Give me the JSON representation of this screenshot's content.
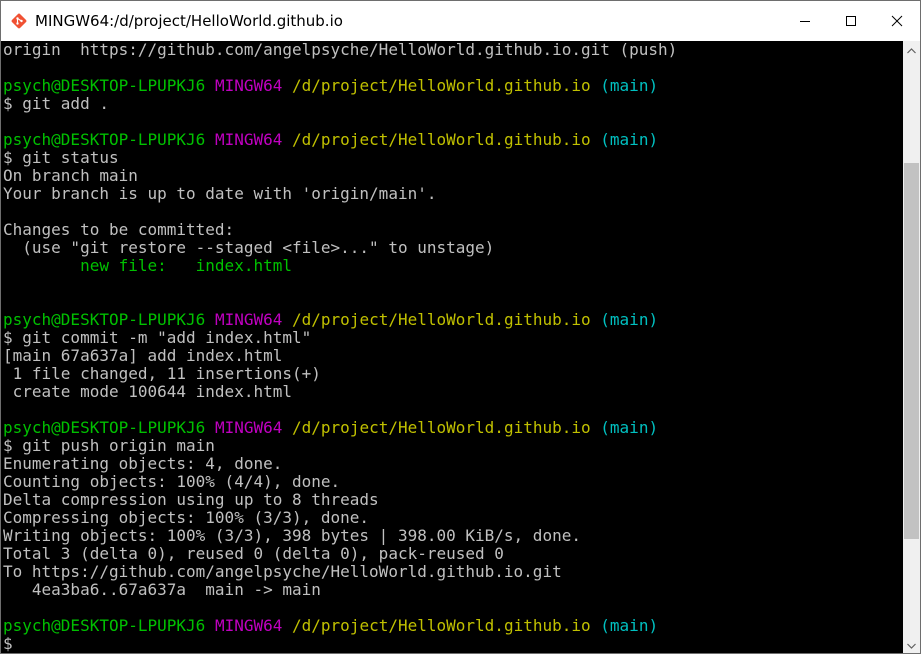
{
  "window": {
    "title": "MINGW64:/d/project/HelloWorld.github.io",
    "icon": "git-bash-icon",
    "controls": [
      "minimize-icon",
      "maximize-icon",
      "close-icon"
    ]
  },
  "colors": {
    "user": "#00c000",
    "msystem": "#c000c0",
    "path": "#c0c000",
    "branch": "#00c0c0",
    "text": "#c0c0c0",
    "background": "#000000"
  },
  "scrollbar": {
    "position": 0.52,
    "visible_fraction": 0.65
  },
  "terminal": {
    "lines": [
      [
        {
          "t": "origin  https://github.com/angelpsyche/HelloWorld.github.io.git (push)",
          "c": "text"
        }
      ],
      [],
      [
        {
          "t": "psych@DESKTOP-LPUPKJ6",
          "c": "user"
        },
        {
          "t": " ",
          "c": "text"
        },
        {
          "t": "MINGW64",
          "c": "msys"
        },
        {
          "t": " ",
          "c": "text"
        },
        {
          "t": "/d/project/HelloWorld.github.io",
          "c": "path"
        },
        {
          "t": " ",
          "c": "text"
        },
        {
          "t": "(main)",
          "c": "branch"
        }
      ],
      [
        {
          "t": "$ git add .",
          "c": "text"
        }
      ],
      [],
      [
        {
          "t": "psych@DESKTOP-LPUPKJ6",
          "c": "user"
        },
        {
          "t": " ",
          "c": "text"
        },
        {
          "t": "MINGW64",
          "c": "msys"
        },
        {
          "t": " ",
          "c": "text"
        },
        {
          "t": "/d/project/HelloWorld.github.io",
          "c": "path"
        },
        {
          "t": " ",
          "c": "text"
        },
        {
          "t": "(main)",
          "c": "branch"
        }
      ],
      [
        {
          "t": "$ git status",
          "c": "text"
        }
      ],
      [
        {
          "t": "On branch main",
          "c": "text"
        }
      ],
      [
        {
          "t": "Your branch is up to date with 'origin/main'.",
          "c": "text"
        }
      ],
      [],
      [
        {
          "t": "Changes to be committed:",
          "c": "text"
        }
      ],
      [
        {
          "t": "  (use \"git restore --staged <file>...\" to unstage)",
          "c": "text"
        }
      ],
      [
        {
          "t": "        ",
          "c": "text"
        },
        {
          "t": "new file:   index.html",
          "c": "new"
        }
      ],
      [],
      [],
      [
        {
          "t": "psych@DESKTOP-LPUPKJ6",
          "c": "user"
        },
        {
          "t": " ",
          "c": "text"
        },
        {
          "t": "MINGW64",
          "c": "msys"
        },
        {
          "t": " ",
          "c": "text"
        },
        {
          "t": "/d/project/HelloWorld.github.io",
          "c": "path"
        },
        {
          "t": " ",
          "c": "text"
        },
        {
          "t": "(main)",
          "c": "branch"
        }
      ],
      [
        {
          "t": "$ git commit -m \"add index.html\"",
          "c": "text"
        }
      ],
      [
        {
          "t": "[main 67a637a] add index.html",
          "c": "text"
        }
      ],
      [
        {
          "t": " 1 file changed, 11 insertions(+)",
          "c": "text"
        }
      ],
      [
        {
          "t": " create mode 100644 index.html",
          "c": "text"
        }
      ],
      [],
      [
        {
          "t": "psych@DESKTOP-LPUPKJ6",
          "c": "user"
        },
        {
          "t": " ",
          "c": "text"
        },
        {
          "t": "MINGW64",
          "c": "msys"
        },
        {
          "t": " ",
          "c": "text"
        },
        {
          "t": "/d/project/HelloWorld.github.io",
          "c": "path"
        },
        {
          "t": " ",
          "c": "text"
        },
        {
          "t": "(main)",
          "c": "branch"
        }
      ],
      [
        {
          "t": "$ git push origin main",
          "c": "text"
        }
      ],
      [
        {
          "t": "Enumerating objects: 4, done.",
          "c": "text"
        }
      ],
      [
        {
          "t": "Counting objects: 100% (4/4), done.",
          "c": "text"
        }
      ],
      [
        {
          "t": "Delta compression using up to 8 threads",
          "c": "text"
        }
      ],
      [
        {
          "t": "Compressing objects: 100% (3/3), done.",
          "c": "text"
        }
      ],
      [
        {
          "t": "Writing objects: 100% (3/3), 398 bytes | 398.00 KiB/s, done.",
          "c": "text"
        }
      ],
      [
        {
          "t": "Total 3 (delta 0), reused 0 (delta 0), pack-reused 0",
          "c": "text"
        }
      ],
      [
        {
          "t": "To https://github.com/angelpsyche/HelloWorld.github.io.git",
          "c": "text"
        }
      ],
      [
        {
          "t": "   4ea3ba6..67a637a  main -> main",
          "c": "text"
        }
      ],
      [],
      [
        {
          "t": "psych@DESKTOP-LPUPKJ6",
          "c": "user"
        },
        {
          "t": " ",
          "c": "text"
        },
        {
          "t": "MINGW64",
          "c": "msys"
        },
        {
          "t": " ",
          "c": "text"
        },
        {
          "t": "/d/project/HelloWorld.github.io",
          "c": "path"
        },
        {
          "t": " ",
          "c": "text"
        },
        {
          "t": "(main)",
          "c": "branch"
        }
      ],
      [
        {
          "t": "$",
          "c": "text"
        }
      ]
    ]
  }
}
